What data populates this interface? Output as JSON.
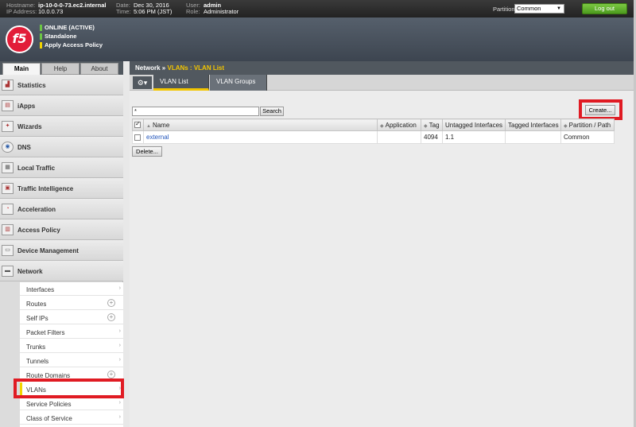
{
  "topbar": {
    "hostname_key": "Hostname:",
    "hostname": "ip-10-0-0-73.ec2.internal",
    "ip_key": "IP Address:",
    "ip": "10.0.0.73",
    "date_key": "Date:",
    "date": "Dec 30, 2016",
    "time_key": "Time:",
    "time": "5:06 PM (JST)",
    "user_key": "User:",
    "user": "admin",
    "role_key": "Role:",
    "role": "Administrator",
    "partition_label": "Partition:",
    "partition_value": "Common",
    "logout_label": "Log out"
  },
  "banner": {
    "logo_text": "f5",
    "status": [
      {
        "text": "ONLINE (ACTIVE)",
        "color": "#6cc644"
      },
      {
        "text": "Standalone",
        "color": "#6cc644"
      },
      {
        "text": "Apply Access Policy",
        "color": "#f2d400"
      }
    ]
  },
  "left_tabs": [
    "Main",
    "Help",
    "About"
  ],
  "nav_items": [
    {
      "label": "Statistics",
      "icon": "statistics-icon"
    },
    {
      "label": "iApps",
      "icon": "iapps-icon"
    },
    {
      "label": "Wizards",
      "icon": "wizards-icon"
    },
    {
      "label": "DNS",
      "icon": "dns-icon"
    },
    {
      "label": "Local Traffic",
      "icon": "local-traffic-icon"
    },
    {
      "label": "Traffic Intelligence",
      "icon": "traffic-intelligence-icon"
    },
    {
      "label": "Acceleration",
      "icon": "acceleration-icon"
    },
    {
      "label": "Access Policy",
      "icon": "access-policy-icon"
    },
    {
      "label": "Device Management",
      "icon": "device-management-icon"
    },
    {
      "label": "Network",
      "icon": "network-icon"
    }
  ],
  "network_submenu": [
    {
      "label": "Interfaces",
      "control": "arrow"
    },
    {
      "label": "Routes",
      "control": "plus"
    },
    {
      "label": "Self IPs",
      "control": "plus"
    },
    {
      "label": "Packet Filters",
      "control": "arrow"
    },
    {
      "label": "Trunks",
      "control": "arrow"
    },
    {
      "label": "Tunnels",
      "control": "arrow"
    },
    {
      "label": "Route Domains",
      "control": "plus"
    },
    {
      "label": "VLANs",
      "control": "arrow"
    },
    {
      "label": "Service Policies",
      "control": "arrow"
    },
    {
      "label": "Class of Service",
      "control": "arrow"
    }
  ],
  "breadcrumb": {
    "section": "Network",
    "separator": "»",
    "page": "VLANs : VLAN List"
  },
  "subtabs": [
    "VLAN List",
    "VLAN Groups"
  ],
  "search": {
    "value": "*",
    "button": "Search"
  },
  "create_button": "Create...",
  "table": {
    "columns": [
      "Name",
      "Application",
      "Tag",
      "Untagged Interfaces",
      "Tagged Interfaces",
      "Partition / Path"
    ],
    "rows": [
      {
        "name": "external",
        "application": "",
        "tag": "4094",
        "untagged": "1.1",
        "tagged": "",
        "partition": "Common"
      }
    ]
  },
  "delete_button": "Delete...",
  "colors": {
    "accent": "#f2c500",
    "highlight": "#e01b23",
    "header_bg": "#51585f"
  }
}
